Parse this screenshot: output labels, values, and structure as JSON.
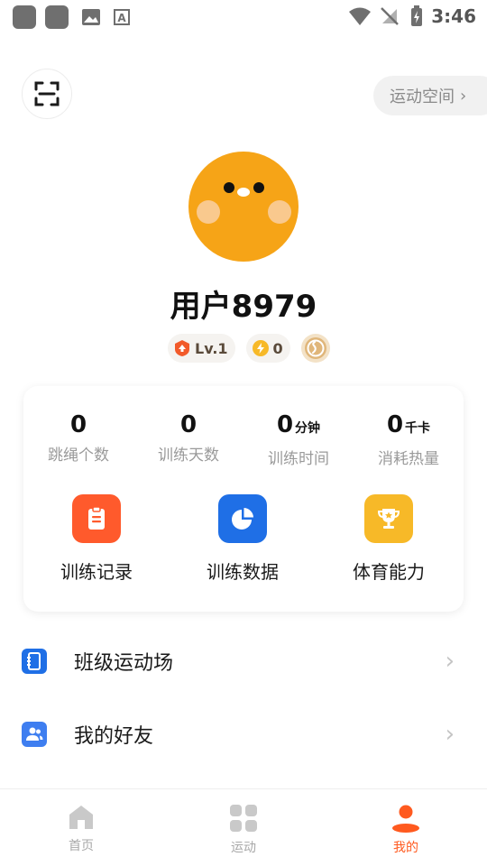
{
  "status_bar": {
    "time": "3:46"
  },
  "header": {
    "sport_space_label": "运动空间"
  },
  "profile": {
    "username": "用户8979",
    "level_label": "Lv.1",
    "points": "0"
  },
  "stats": [
    {
      "value": "0",
      "unit": "",
      "label": "跳绳个数"
    },
    {
      "value": "0",
      "unit": "",
      "label": "训练天数"
    },
    {
      "value": "0",
      "unit": "分钟",
      "label": "训练时间"
    },
    {
      "value": "0",
      "unit": "千卡",
      "label": "消耗热量"
    }
  ],
  "features": [
    {
      "label": "训练记录",
      "icon": "clipboard-icon",
      "color": "#ff5a2c"
    },
    {
      "label": "训练数据",
      "icon": "pie-chart-icon",
      "color": "#1f6fe6"
    },
    {
      "label": "体育能力",
      "icon": "trophy-icon",
      "color": "#f7b928"
    }
  ],
  "menu": [
    {
      "label": "班级运动场",
      "icon": "class-book-icon"
    },
    {
      "label": "我的好友",
      "icon": "friends-icon"
    }
  ],
  "bottom_nav": [
    {
      "label": "首页",
      "icon": "home-icon",
      "active": false
    },
    {
      "label": "运动",
      "icon": "grid-icon",
      "active": false
    },
    {
      "label": "我的",
      "icon": "profile-icon",
      "active": true
    }
  ],
  "colors": {
    "accent": "#ff5a1f",
    "avatar": "#f6a417"
  }
}
